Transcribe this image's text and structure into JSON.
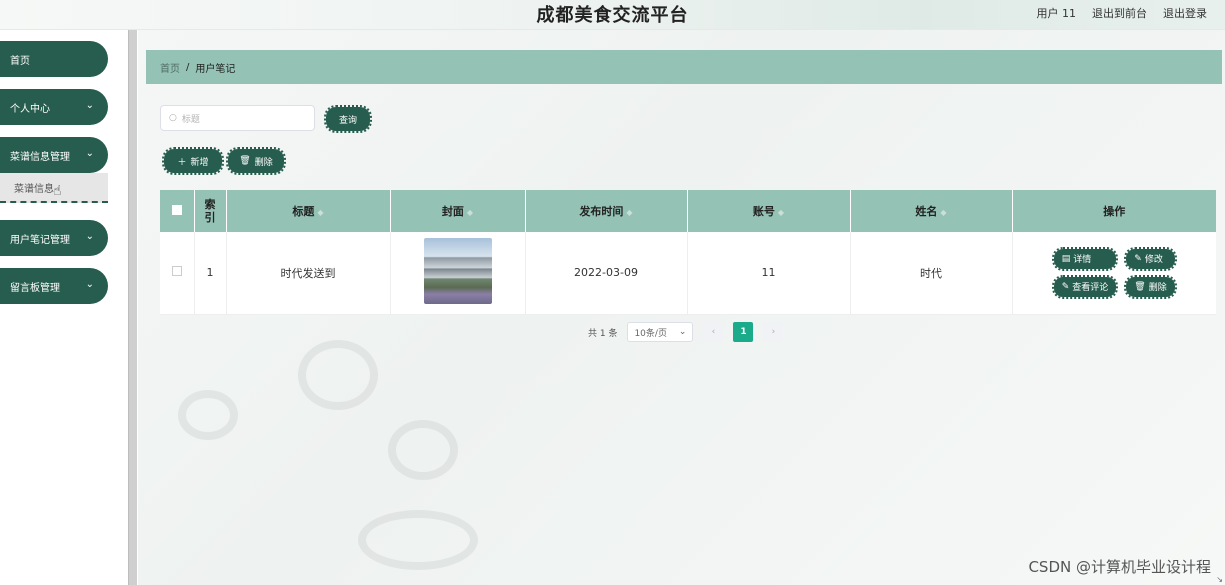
{
  "header": {
    "title": "成都美食交流平台",
    "user_label": "用户 11",
    "back_label": "退出到前台",
    "logout_label": "退出登录"
  },
  "sidebar": {
    "items": [
      {
        "label": "首页"
      },
      {
        "label": "个人中心"
      },
      {
        "label": "菜谱信息管理"
      },
      {
        "label": "用户笔记管理"
      },
      {
        "label": "留言板管理"
      }
    ],
    "sub_item": "菜谱信息"
  },
  "breadcrumb": {
    "home": "首页",
    "separator": "/",
    "current": "用户笔记"
  },
  "search": {
    "placeholder": "标题",
    "button": "查询"
  },
  "actions": {
    "add": "新增",
    "delete": "删除"
  },
  "table": {
    "headers": [
      "",
      "索引",
      "标题",
      "封面",
      "发布时间",
      "账号",
      "姓名",
      "操作"
    ],
    "rows": [
      {
        "index": "1",
        "title": "时代发送到",
        "cover": "cover-image",
        "date": "2022-03-09",
        "account": "11",
        "name": "时代"
      }
    ],
    "row_actions": {
      "detail": "详情",
      "edit": "修改",
      "comments": "查看评论",
      "delete": "删除"
    }
  },
  "pagination": {
    "total": "共 1 条",
    "page_size": "10条/页",
    "current": "1"
  },
  "watermark": "CSDN @计算机毕业设计程",
  "colors": {
    "primary": "#275d4e",
    "header_bg": "#94c3b5",
    "active_page": "#1aab8a"
  }
}
